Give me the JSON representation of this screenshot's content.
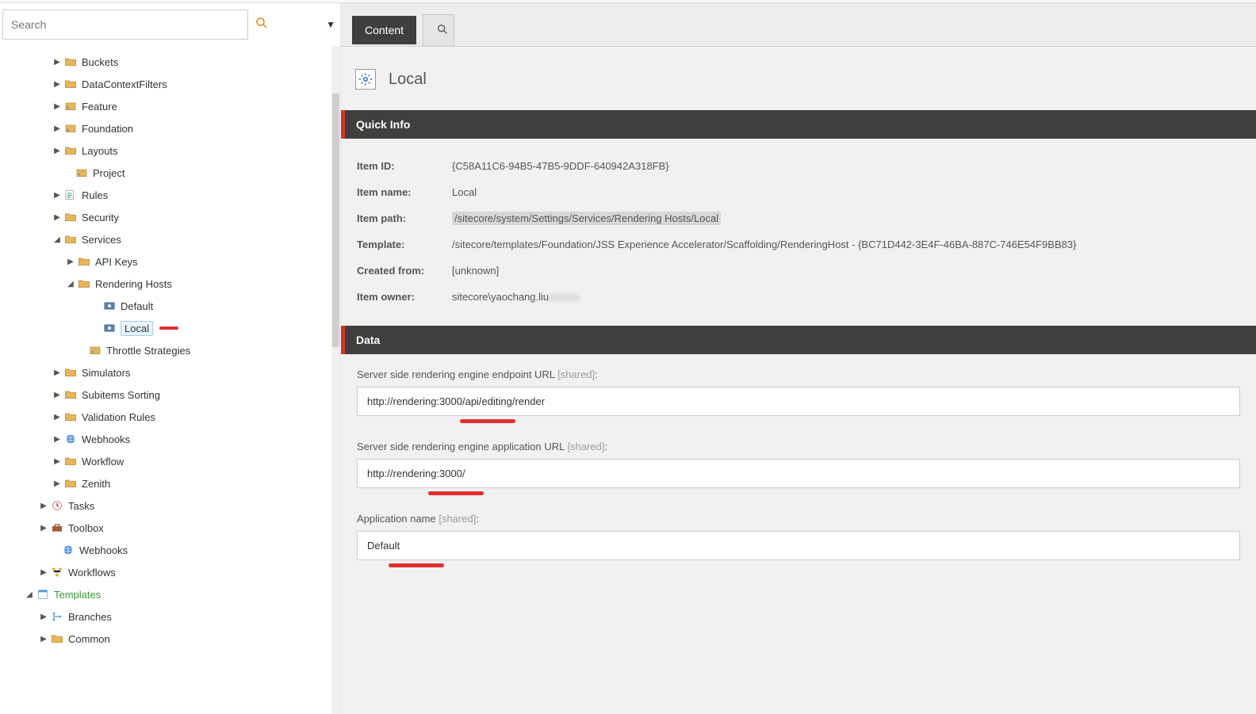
{
  "search": {
    "placeholder": "Search"
  },
  "tree": [
    {
      "label": "Buckets",
      "indent": 65,
      "exp": "▶",
      "icon": "folder"
    },
    {
      "label": "DataContextFilters",
      "indent": 65,
      "exp": "▶",
      "icon": "folder"
    },
    {
      "label": "Feature",
      "indent": 65,
      "exp": "▶",
      "icon": "box"
    },
    {
      "label": "Foundation",
      "indent": 65,
      "exp": "▶",
      "icon": "box"
    },
    {
      "label": "Layouts",
      "indent": 65,
      "exp": "▶",
      "icon": "folder"
    },
    {
      "label": "Project",
      "indent": 79,
      "exp": "",
      "icon": "box"
    },
    {
      "label": "Rules",
      "indent": 65,
      "exp": "▶",
      "icon": "rules"
    },
    {
      "label": "Security",
      "indent": 65,
      "exp": "▶",
      "icon": "folder"
    },
    {
      "label": "Services",
      "indent": 65,
      "exp": "◢",
      "icon": "folder"
    },
    {
      "label": "API Keys",
      "indent": 82,
      "exp": "▶",
      "icon": "folder"
    },
    {
      "label": "Rendering Hosts",
      "indent": 82,
      "exp": "◢",
      "icon": "folder"
    },
    {
      "label": "Default",
      "indent": 114,
      "exp": "",
      "icon": "eye"
    },
    {
      "label": "Local",
      "indent": 114,
      "exp": "",
      "icon": "eye",
      "selected": true,
      "mark": true
    },
    {
      "label": "Throttle Strategies",
      "indent": 96,
      "exp": "",
      "icon": "box"
    },
    {
      "label": "Simulators",
      "indent": 65,
      "exp": "▶",
      "icon": "folder"
    },
    {
      "label": "Subitems Sorting",
      "indent": 65,
      "exp": "▶",
      "icon": "folder"
    },
    {
      "label": "Validation Rules",
      "indent": 65,
      "exp": "▶",
      "icon": "folder"
    },
    {
      "label": "Webhooks",
      "indent": 65,
      "exp": "▶",
      "icon": "globe"
    },
    {
      "label": "Workflow",
      "indent": 65,
      "exp": "▶",
      "icon": "folder"
    },
    {
      "label": "Zenith",
      "indent": 65,
      "exp": "▶",
      "icon": "folder"
    },
    {
      "label": "Tasks",
      "indent": 48,
      "exp": "▶",
      "icon": "tasks"
    },
    {
      "label": "Toolbox",
      "indent": 48,
      "exp": "▶",
      "icon": "toolbox"
    },
    {
      "label": "Webhooks",
      "indent": 62,
      "exp": "",
      "icon": "globe"
    },
    {
      "label": "Workflows",
      "indent": 48,
      "exp": "▶",
      "icon": "workflow"
    },
    {
      "label": "Templates",
      "indent": 30,
      "exp": "◢",
      "icon": "template",
      "green": true
    },
    {
      "label": "Branches",
      "indent": 48,
      "exp": "▶",
      "icon": "branch"
    },
    {
      "label": "Common",
      "indent": 48,
      "exp": "▶",
      "icon": "folder"
    }
  ],
  "tabs": {
    "content": "Content"
  },
  "page": {
    "title": "Local"
  },
  "sections": {
    "quickinfo": "Quick Info",
    "data": "Data"
  },
  "info": {
    "item_id_label": "Item ID:",
    "item_id": "{C58A11C6-94B5-47B5-9DDF-640942A318FB}",
    "item_name_label": "Item name:",
    "item_name": "Local",
    "item_path_label": "Item path:",
    "item_path": "/sitecore/system/Settings/Services/Rendering Hosts/Local",
    "template_label": "Template:",
    "template": "/sitecore/templates/Foundation/JSS Experience Accelerator/Scaffolding/RenderingHost - {BC71D442-3E4F-46BA-887C-746E54F9BB83}",
    "created_label": "Created from:",
    "created": "[unknown]",
    "owner_label": "Item owner:",
    "owner": "sitecore\\yaochang.liu",
    "owner_blur": "xxxxxx"
  },
  "fields": {
    "endpoint_label": "Server side rendering engine endpoint URL ",
    "endpoint_value": "http://rendering:3000/api/editing/render",
    "appurl_label": "Server side rendering engine application URL ",
    "appurl_value": "http://rendering:3000/",
    "appname_label": "Application name ",
    "appname_value": "Default",
    "shared": "[shared]"
  }
}
